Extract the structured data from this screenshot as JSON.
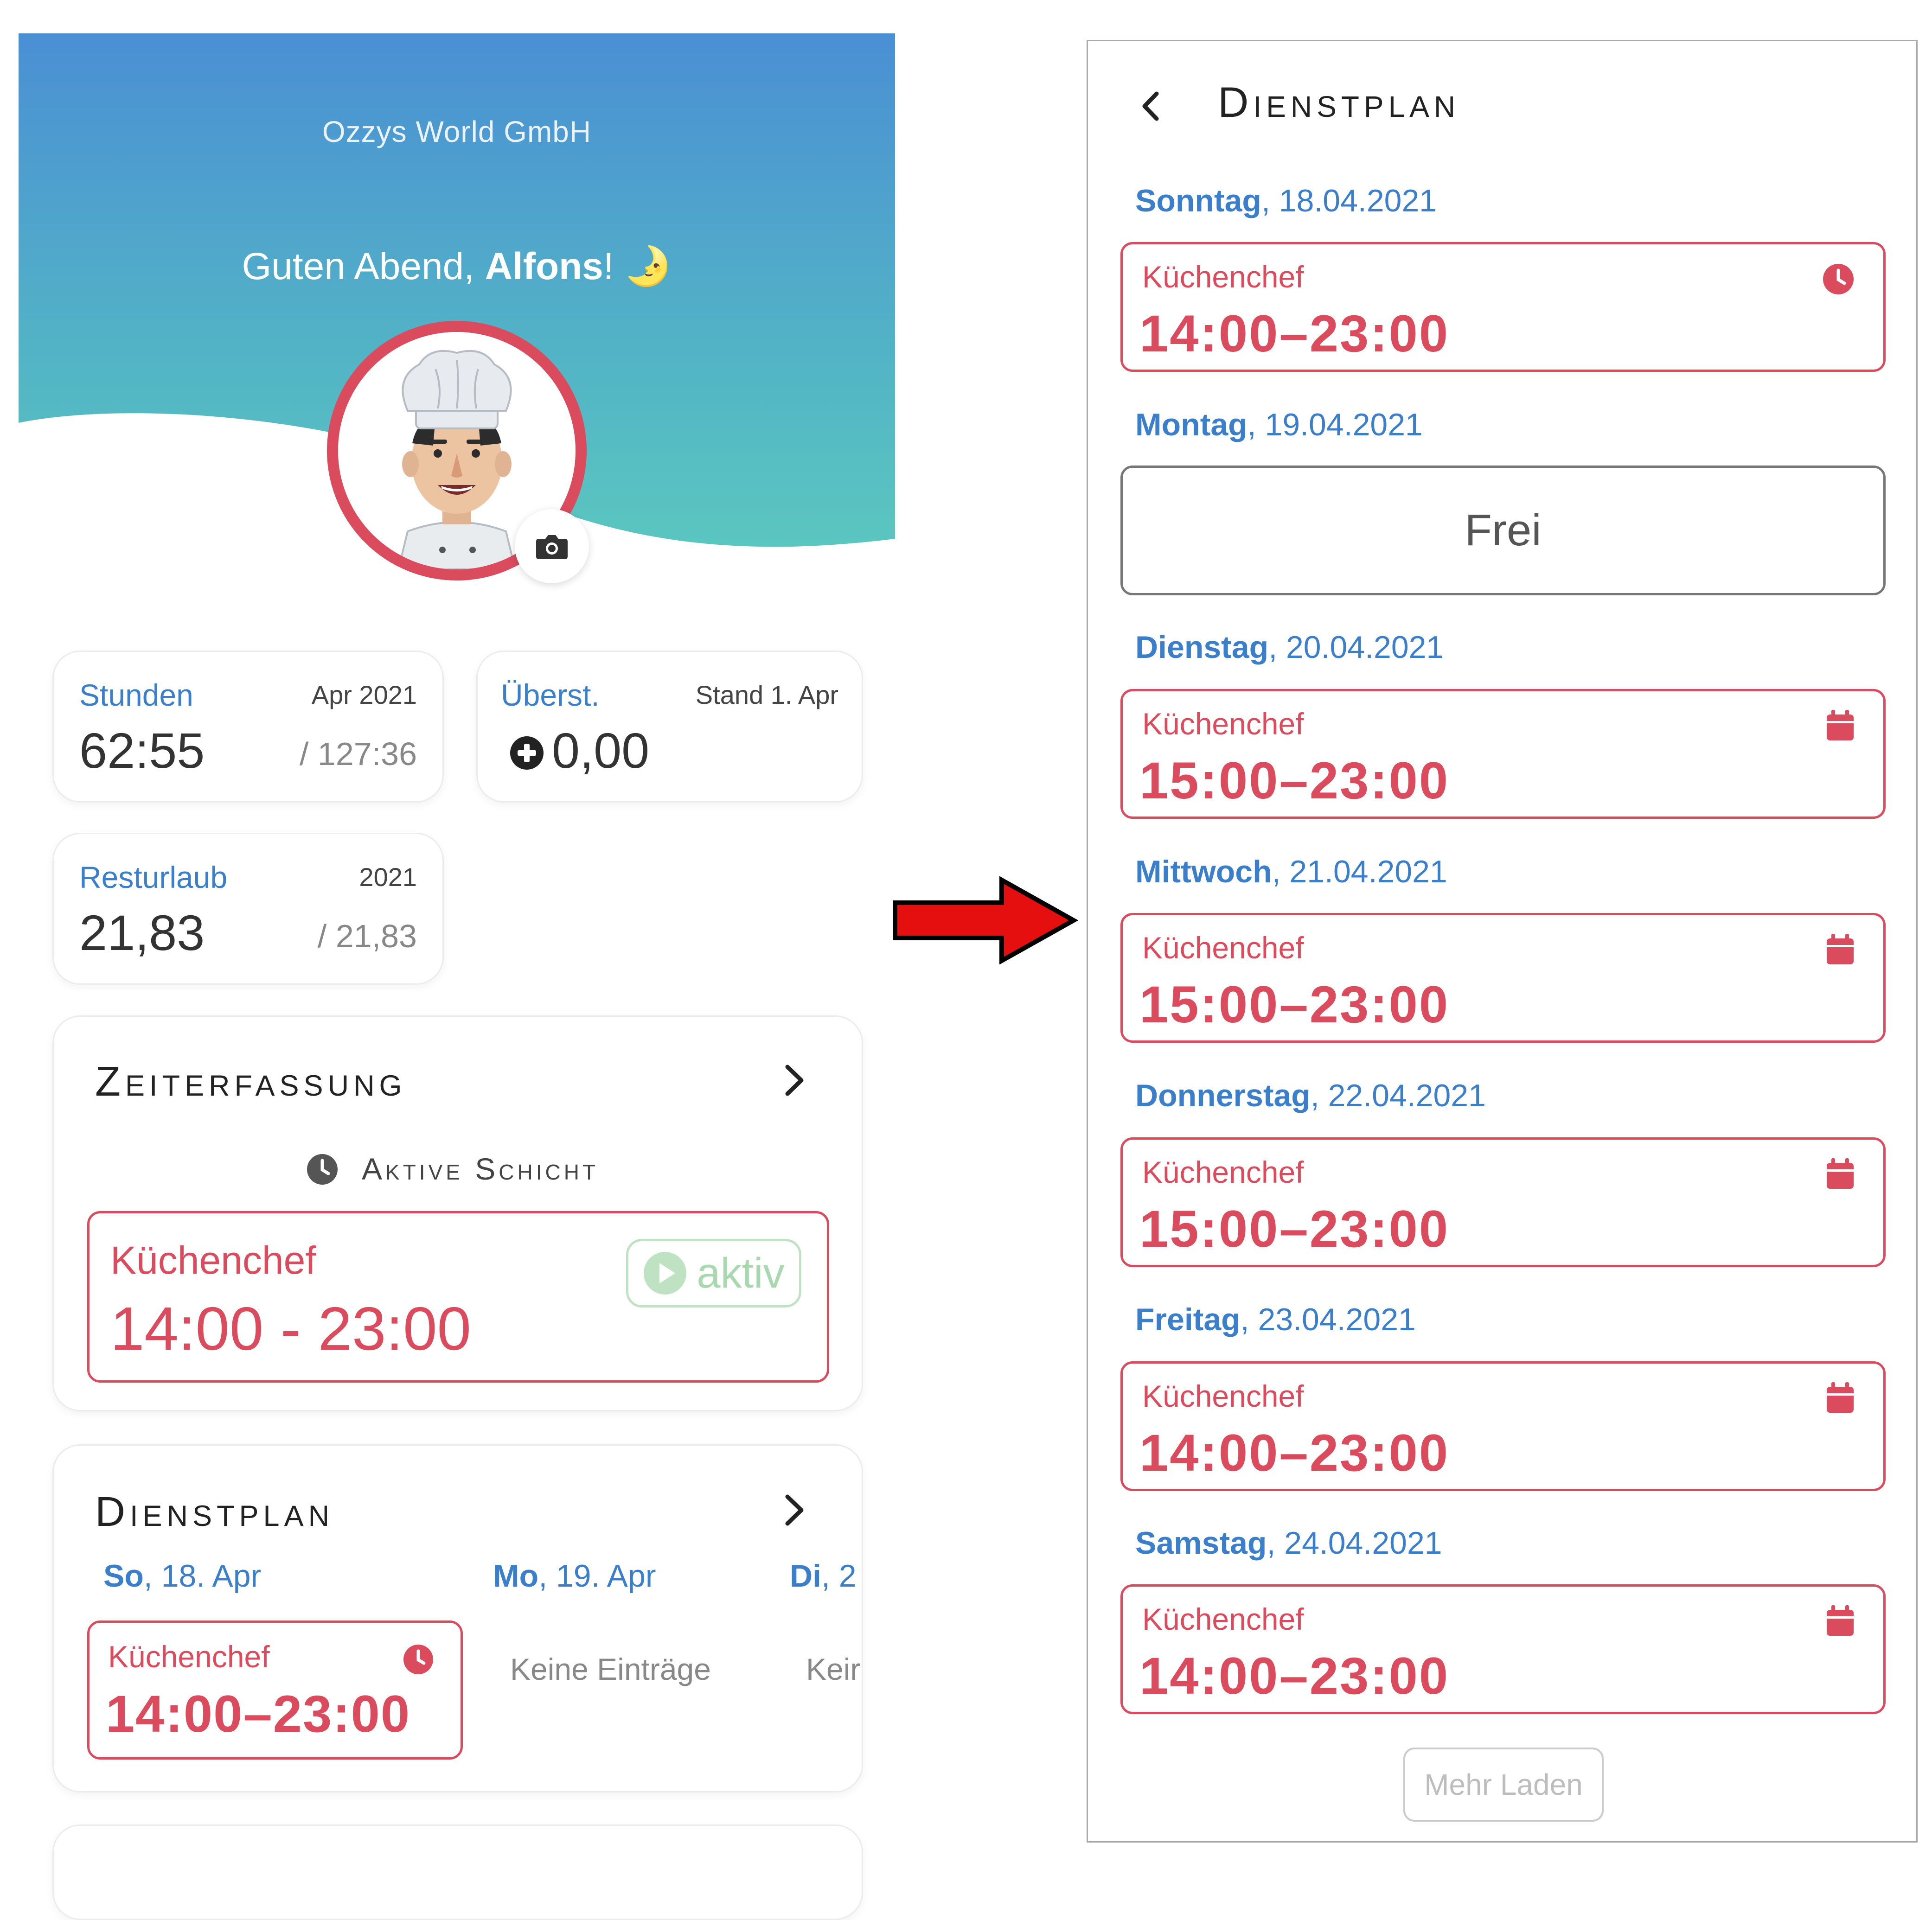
{
  "left": {
    "company": "Ozzys World GmbH",
    "greeting_prefix": "Guten Abend, ",
    "greeting_name": "Alfons",
    "greeting_suffix": "! 🌛",
    "stats": {
      "stunden": {
        "label": "Stunden",
        "meta": "Apr 2021",
        "value": "62:55",
        "total": "/ 127:36"
      },
      "ueberst": {
        "label": "Überst.",
        "meta": "Stand 1. Apr",
        "value": "0,00"
      },
      "resturlaub": {
        "label": "Resturlaub",
        "meta": "2021",
        "value": "21,83",
        "total": "/ 21,83"
      }
    },
    "zeiterfassung": {
      "title": "Zeiterfassung",
      "subtitle": "Aktive Schicht",
      "shift_role": "Küchenchef",
      "shift_time": "14:00 - 23:00",
      "badge": "aktiv"
    },
    "dienstplan": {
      "title": "Dienstplan",
      "days": [
        {
          "abbr": "So",
          "date": ", 18. Apr"
        },
        {
          "abbr": "Mo",
          "date": ", 19. Apr"
        },
        {
          "abbr": "Di",
          "date": ", 2"
        }
      ],
      "shift_role": "Küchenchef",
      "shift_time": "14:00–23:00",
      "empty": "Keine Einträge",
      "empty_cut": "Keir"
    }
  },
  "right": {
    "title": "Dienstplan",
    "days": [
      {
        "weekday": "Sonntag",
        "date": ", 18.04.2021",
        "role": "Küchenchef",
        "time": "14:00–23:00",
        "icon": "clock-icon"
      },
      {
        "weekday": "Montag",
        "date": ", 19.04.2021",
        "free": "Frei"
      },
      {
        "weekday": "Dienstag",
        "date": ", 20.04.2021",
        "role": "Küchenchef",
        "time": "15:00–23:00",
        "icon": "calendar-icon"
      },
      {
        "weekday": "Mittwoch",
        "date": ", 21.04.2021",
        "role": "Küchenchef",
        "time": "15:00–23:00",
        "icon": "calendar-icon"
      },
      {
        "weekday": "Donnerstag",
        "date": ", 22.04.2021",
        "role": "Küchenchef",
        "time": "15:00–23:00",
        "icon": "calendar-icon"
      },
      {
        "weekday": "Freitag",
        "date": ", 23.04.2021",
        "role": "Küchenchef",
        "time": "14:00–23:00",
        "icon": "calendar-icon"
      },
      {
        "weekday": "Samstag",
        "date": ", 24.04.2021",
        "role": "Küchenchef",
        "time": "14:00–23:00",
        "icon": "calendar-icon"
      }
    ],
    "more_button": "Mehr Laden"
  },
  "colors": {
    "accent_red": "#d94b5d",
    "accent_blue": "#3b7fcb",
    "active_green": "#a8d8ad"
  }
}
